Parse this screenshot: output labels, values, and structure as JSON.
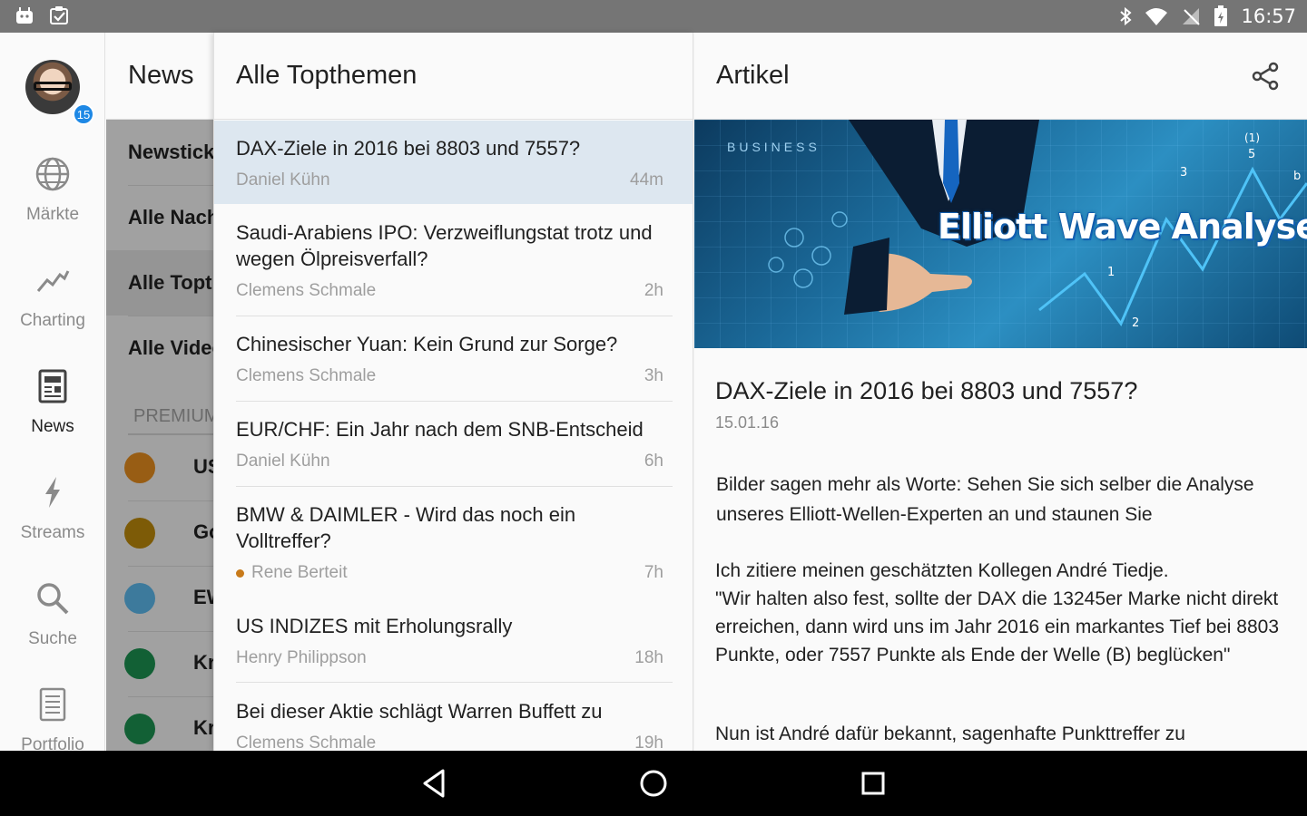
{
  "status": {
    "time": "16:57"
  },
  "rail": {
    "badge": "15",
    "items": [
      {
        "label": "Märkte",
        "icon": "globe-icon"
      },
      {
        "label": "Charting",
        "icon": "chart-line-icon"
      },
      {
        "label": "News",
        "icon": "newspaper-icon"
      },
      {
        "label": "Streams",
        "icon": "lightning-icon"
      },
      {
        "label": "Suche",
        "icon": "search-icon"
      },
      {
        "label": "Portfolio",
        "icon": "list-icon"
      }
    ]
  },
  "categories": {
    "header": "News",
    "items": [
      "Newsticker",
      "Alle Nachrichten",
      "Alle Topthemen",
      "Alle Videos"
    ],
    "premium_label": "PREMIUM",
    "premium_items": [
      {
        "label": "US",
        "color": "#e08a1e"
      },
      {
        "label": "Go",
        "color": "#b8860b"
      },
      {
        "label": "EW",
        "color": "#5ab4e6"
      },
      {
        "label": "Kr",
        "color": "#1b8e4e"
      },
      {
        "label": "Kr",
        "color": "#1b8e4e"
      }
    ]
  },
  "list": {
    "header": "Alle Topthemen",
    "articles": [
      {
        "title": "DAX-Ziele in 2016 bei 8803 und 7557?",
        "author": "Daniel Kühn",
        "age": "44m"
      },
      {
        "title": "Saudi-Arabiens IPO: Verzweiflungstat trotz und wegen Ölpreisverfall?",
        "author": "Clemens Schmale",
        "age": "2h"
      },
      {
        "title": "Chinesischer Yuan: Kein Grund zur Sorge?",
        "author": "Clemens Schmale",
        "age": "3h"
      },
      {
        "title": "EUR/CHF: Ein Jahr nach dem SNB-Entscheid",
        "author": "Daniel Kühn",
        "age": "6h"
      },
      {
        "title": "BMW & DAIMLER - Wird das noch ein Volltreffer?",
        "author": "Rene Berteit",
        "age": "7h"
      },
      {
        "title": "US INDIZES mit Erholungsrally",
        "author": "Henry Philippson",
        "age": "18h"
      },
      {
        "title": "Bei dieser Aktie schlägt Warren Buffett zu",
        "author": "Clemens Schmale",
        "age": "19h"
      }
    ]
  },
  "detail": {
    "header": "Artikel",
    "hero_text": "Elliott Wave Analysen",
    "hero_business": "BUSINESS",
    "title": "DAX-Ziele in 2016 bei 8803 und 7557?",
    "date": "15.01.16",
    "p1": "Bilder sagen mehr als Worte: Sehen Sie sich selber die Analyse unseres Elliott-Wellen-Experten an und staunen Sie",
    "p2a": "Ich zitiere meinen geschätzten Kollegen André Tiedje.",
    "p2b": "\"Wir halten also fest, sollte der DAX die 13245er Marke nicht direkt erreichen, dann wird uns im Jahr 2016 ein markantes Tief bei 8803 Punkte, oder 7557 Punkte als Ende der Welle (B) beglücken\"",
    "p3": "Nun ist André dafür bekannt, sagenhafte Punkttreffer zu"
  }
}
